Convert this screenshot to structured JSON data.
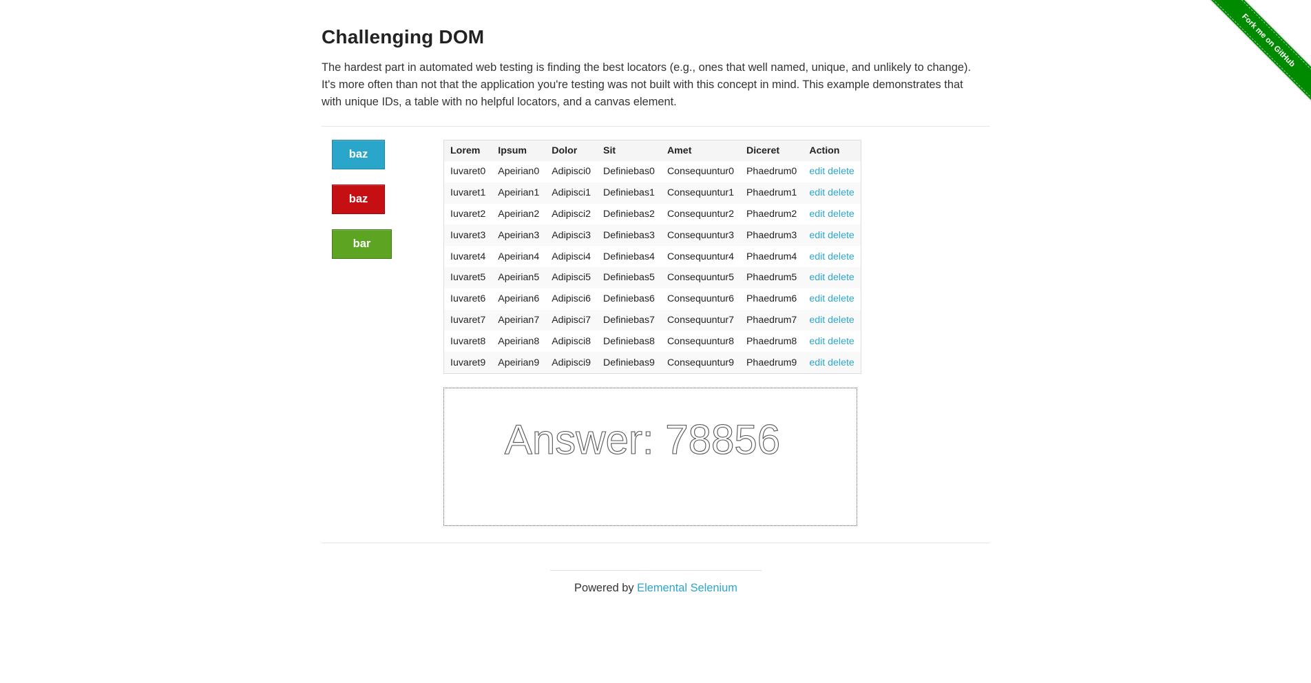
{
  "page": {
    "title": "Challenging DOM",
    "description": "The hardest part in automated web testing is finding the best locators (e.g., ones that well named, unique, and unlikely to change). It's more often than not that the application you're testing was not built with this concept in mind. This example demonstrates that with unique IDs, a table with no helpful locators, and a canvas element."
  },
  "buttons": {
    "blue_label": "baz",
    "red_label": "baz",
    "green_label": "bar",
    "green_glyph": "",
    "colors": {
      "blue": "#2ba6cb",
      "red": "#c60f13",
      "green": "#5da423"
    }
  },
  "table": {
    "headers": [
      "Lorem",
      "Ipsum",
      "Dolor",
      "Sit",
      "Amet",
      "Diceret",
      "Action"
    ],
    "rows": [
      [
        "Iuvaret0",
        "Apeirian0",
        "Adipisci0",
        "Definiebas0",
        "Consequuntur0",
        "Phaedrum0"
      ],
      [
        "Iuvaret1",
        "Apeirian1",
        "Adipisci1",
        "Definiebas1",
        "Consequuntur1",
        "Phaedrum1"
      ],
      [
        "Iuvaret2",
        "Apeirian2",
        "Adipisci2",
        "Definiebas2",
        "Consequuntur2",
        "Phaedrum2"
      ],
      [
        "Iuvaret3",
        "Apeirian3",
        "Adipisci3",
        "Definiebas3",
        "Consequuntur3",
        "Phaedrum3"
      ],
      [
        "Iuvaret4",
        "Apeirian4",
        "Adipisci4",
        "Definiebas4",
        "Consequuntur4",
        "Phaedrum4"
      ],
      [
        "Iuvaret5",
        "Apeirian5",
        "Adipisci5",
        "Definiebas5",
        "Consequuntur5",
        "Phaedrum5"
      ],
      [
        "Iuvaret6",
        "Apeirian6",
        "Adipisci6",
        "Definiebas6",
        "Consequuntur6",
        "Phaedrum6"
      ],
      [
        "Iuvaret7",
        "Apeirian7",
        "Adipisci7",
        "Definiebas7",
        "Consequuntur7",
        "Phaedrum7"
      ],
      [
        "Iuvaret8",
        "Apeirian8",
        "Adipisci8",
        "Definiebas8",
        "Consequuntur8",
        "Phaedrum8"
      ],
      [
        "Iuvaret9",
        "Apeirian9",
        "Adipisci9",
        "Definiebas9",
        "Consequuntur9",
        "Phaedrum9"
      ]
    ],
    "action_edit": "edit",
    "action_delete": "delete",
    "link_color": "#2ba6cb"
  },
  "canvas": {
    "answer_text": "Answer: 78856"
  },
  "footer": {
    "powered_by": "Powered by",
    "link_text": "Elemental Selenium"
  },
  "ribbon": {
    "label": "Fork me on GitHub",
    "color": "#008a00"
  }
}
